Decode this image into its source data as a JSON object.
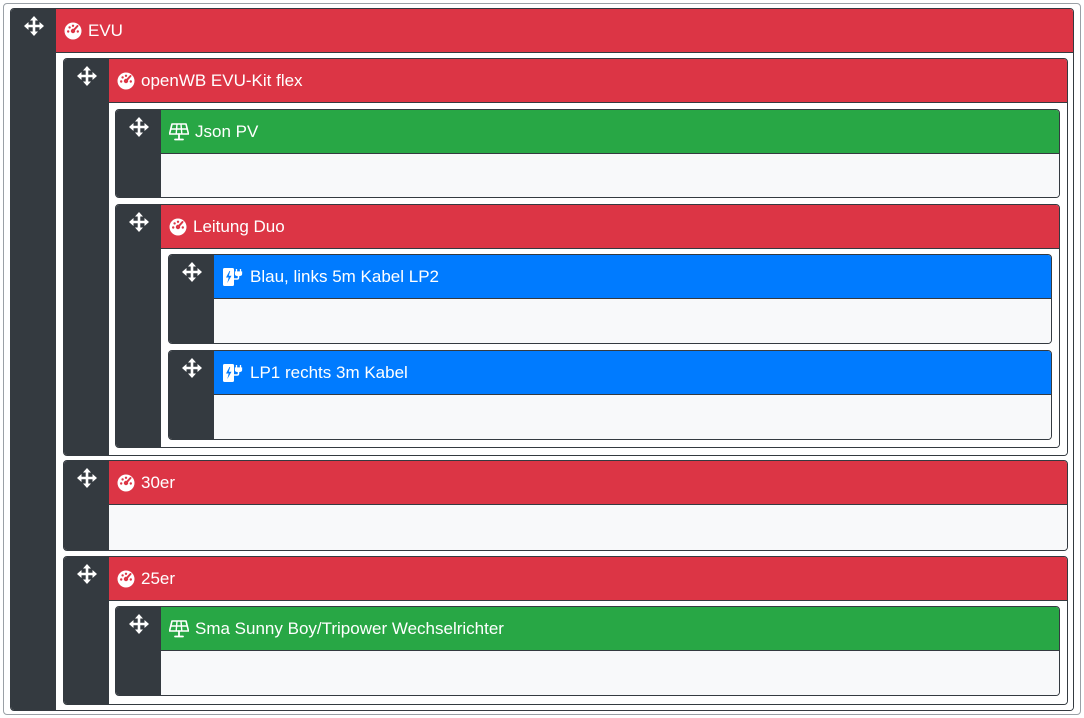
{
  "tree": {
    "evu": {
      "label": "EVU",
      "icon": "gauge-icon",
      "color": "#dc3545"
    },
    "evu_kit": {
      "label": "openWB EVU-Kit flex",
      "icon": "gauge-icon",
      "color": "#dc3545"
    },
    "json_pv": {
      "label": "Json PV",
      "icon": "solar-panel-icon",
      "color": "#28a745"
    },
    "leitung_duo": {
      "label": "Leitung Duo",
      "icon": "gauge-icon",
      "color": "#dc3545"
    },
    "lp2": {
      "label": "Blau, links 5m Kabel LP2",
      "icon": "charging-station-icon",
      "color": "#007bff"
    },
    "lp1": {
      "label": "LP1 rechts 3m Kabel",
      "icon": "charging-station-icon",
      "color": "#007bff"
    },
    "c30er": {
      "label": "30er",
      "icon": "gauge-icon",
      "color": "#dc3545"
    },
    "c25er": {
      "label": "25er",
      "icon": "gauge-icon",
      "color": "#dc3545"
    },
    "sma": {
      "label": "Sma Sunny Boy/Tripower Wechselrichter",
      "icon": "solar-panel-icon",
      "color": "#28a745"
    }
  },
  "handle_icon": "arrows-move-icon",
  "colors": {
    "handle": "#343a40",
    "body": "#f8f9fa"
  }
}
